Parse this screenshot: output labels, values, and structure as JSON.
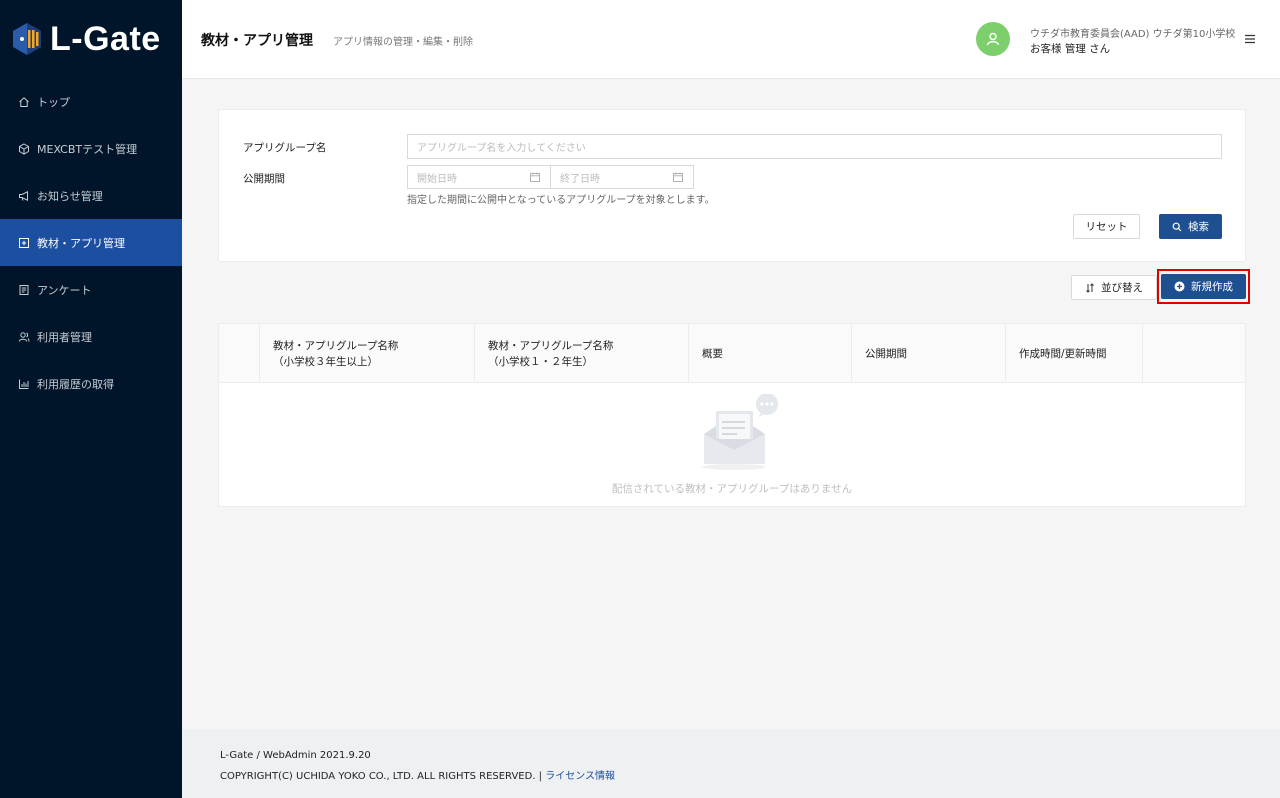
{
  "brand": {
    "name": "L-Gate"
  },
  "sidebar": {
    "items": [
      {
        "label": "トップ",
        "icon": "home-icon",
        "active": false
      },
      {
        "label": "MEXCBTテスト管理",
        "icon": "cube-icon",
        "active": false
      },
      {
        "label": "お知らせ管理",
        "icon": "megaphone-icon",
        "active": false
      },
      {
        "label": "教材・アプリ管理",
        "icon": "plus-square-icon",
        "active": true
      },
      {
        "label": "アンケート",
        "icon": "form-icon",
        "active": false
      },
      {
        "label": "利用者管理",
        "icon": "users-icon",
        "active": false
      },
      {
        "label": "利用履歴の取得",
        "icon": "bar-chart-icon",
        "active": false
      }
    ]
  },
  "header": {
    "title": "教材・アプリ管理",
    "subtitle": "アプリ情報の管理・編集・削除",
    "user_org": "ウチダ市教育委員会(AAD)  ウチダ第10小学校",
    "user_name": "お客様 管理 さん"
  },
  "search": {
    "group_label": "アプリグループ名",
    "group_placeholder": "アプリグループ名を入力してください",
    "period_label": "公開期間",
    "start_placeholder": "開始日時",
    "end_placeholder": "終了日時",
    "hint": "指定した期間に公開中となっているアプリグループを対象とします。",
    "reset_label": "リセット",
    "search_label": "検索"
  },
  "actions": {
    "sort_label": "並び替え",
    "create_label": "新規作成"
  },
  "table": {
    "columns": [
      {
        "line1": "",
        "line2": ""
      },
      {
        "line1": "教材・アプリグループ名称",
        "line2": "（小学校３年生以上）"
      },
      {
        "line1": "教材・アプリグループ名称",
        "line2": "（小学校１・２年生）"
      },
      {
        "line1": "概要",
        "line2": ""
      },
      {
        "line1": "公開期間",
        "line2": ""
      },
      {
        "line1": "作成時間/更新時間",
        "line2": ""
      },
      {
        "line1": "",
        "line2": ""
      }
    ],
    "empty_text": "配信されている教材・アプリグループはありません"
  },
  "footer": {
    "version": "L-Gate / WebAdmin 2021.9.20",
    "copyright": "COPYRIGHT(C) UCHIDA YOKO CO., LTD. ALL RIGHTS RESERVED. | ",
    "license_link": "ライセンス情報"
  },
  "colors": {
    "sidebar_bg": "#001529",
    "accent": "#1d4fa0",
    "primary_button": "#1d4f91",
    "highlight": "#e00000",
    "avatar": "#7ccf6b"
  }
}
